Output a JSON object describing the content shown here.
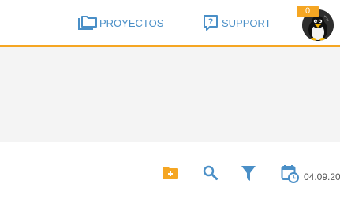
{
  "header": {
    "nav": {
      "projects_label": "PROYECTOS",
      "support_label": "SUPPORT"
    },
    "notification_count": "0",
    "accent_color": "#f5a623",
    "link_color": "#4a8fc7"
  },
  "toolbar": {
    "icons": [
      "create-folder-icon",
      "search-icon",
      "filter-icon",
      "calendar-clock-icon"
    ],
    "date_text": "04.09.20"
  }
}
